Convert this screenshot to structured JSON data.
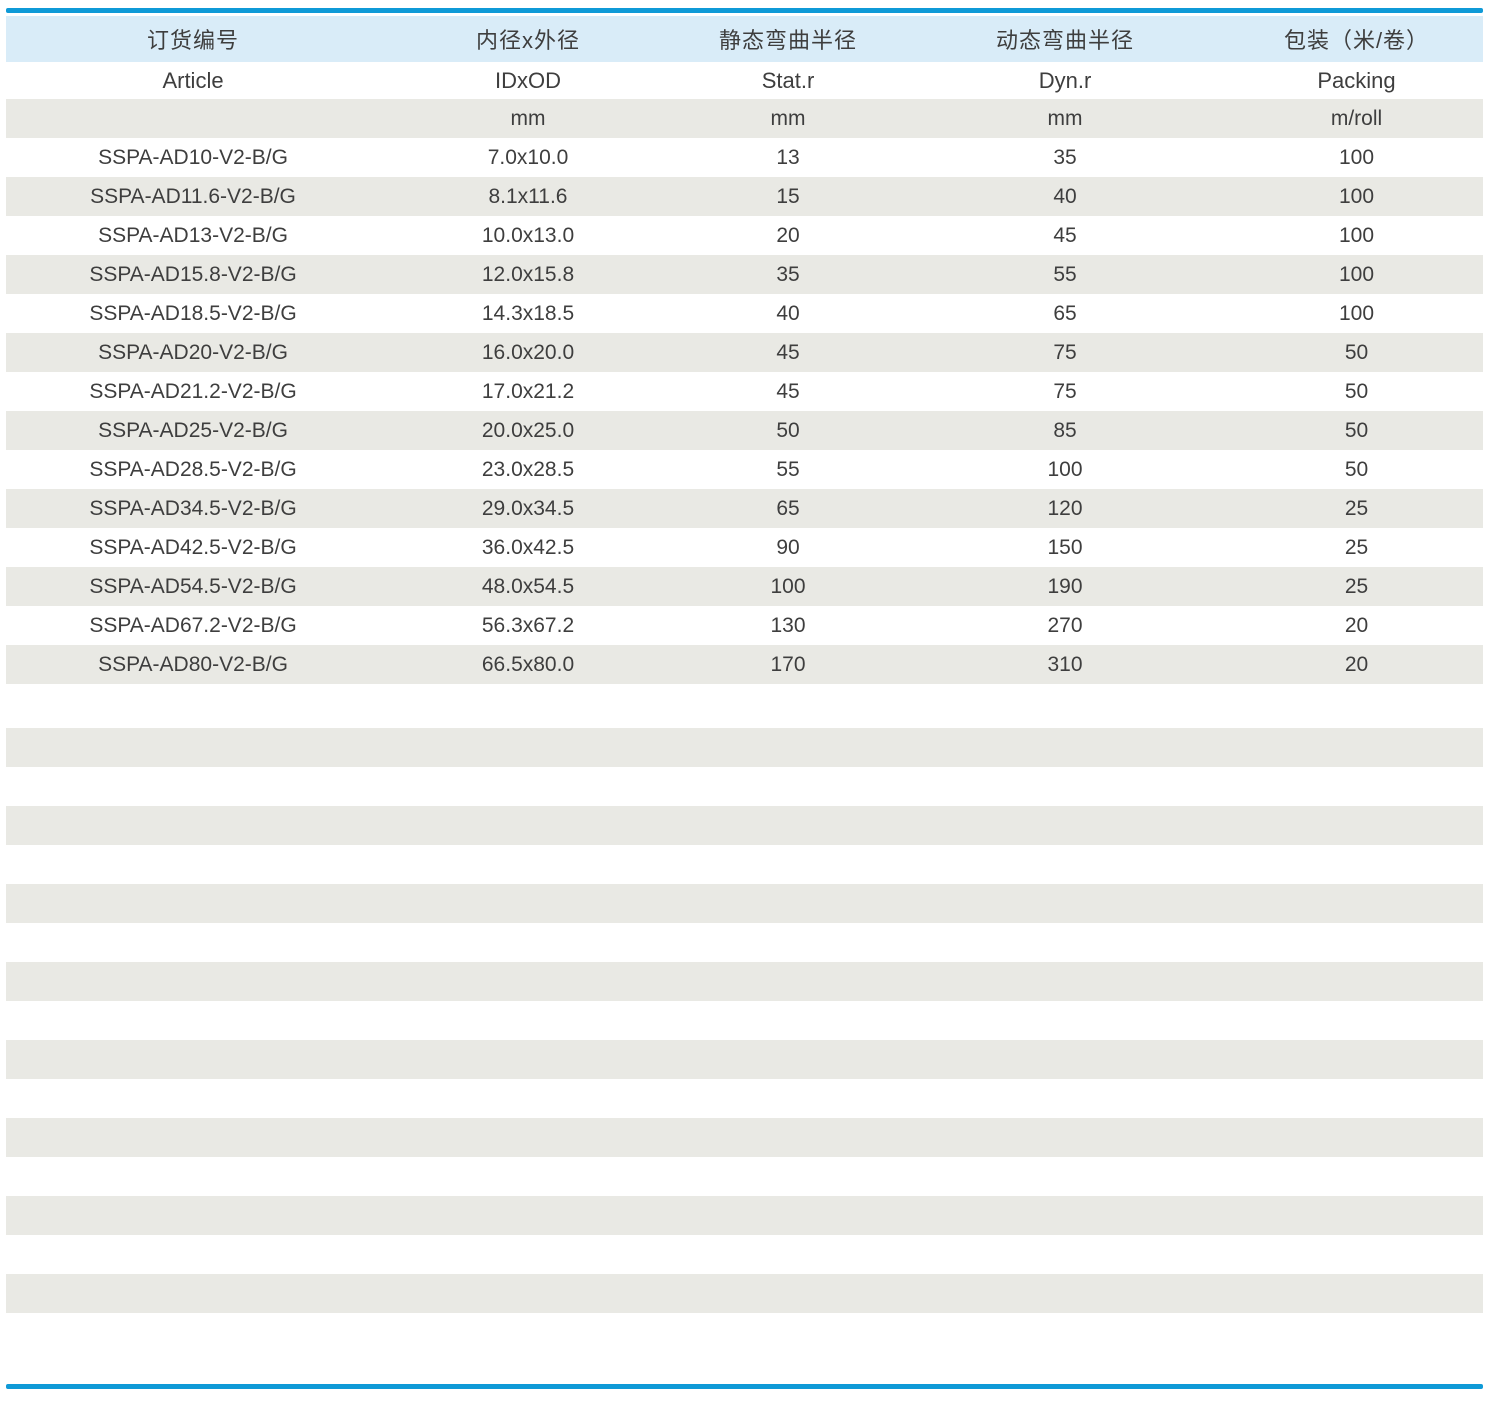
{
  "colors": {
    "accent_blue": "#0f9ad7",
    "header_band_blue": "#d9ecf8",
    "zebra_stripe_gray": "#e9e9e4",
    "text": "#3e3e3e"
  },
  "table": {
    "columns": [
      {
        "zh": "订货编号",
        "en": "Article",
        "unit": ""
      },
      {
        "zh": "内径x外径",
        "en": "IDxOD",
        "unit": "mm"
      },
      {
        "zh": "静态弯曲半径",
        "en": "Stat.r",
        "unit": "mm"
      },
      {
        "zh": "动态弯曲半径",
        "en": "Dyn.r",
        "unit": "mm"
      },
      {
        "zh": "包装（米/卷）",
        "en": "Packing",
        "unit": "m/roll"
      }
    ],
    "rows": [
      [
        "SSPA-AD10-V2-B/G",
        "7.0x10.0",
        "13",
        "35",
        "100"
      ],
      [
        "SSPA-AD11.6-V2-B/G",
        "8.1x11.6",
        "15",
        "40",
        "100"
      ],
      [
        "SSPA-AD13-V2-B/G",
        "10.0x13.0",
        "20",
        "45",
        "100"
      ],
      [
        "SSPA-AD15.8-V2-B/G",
        "12.0x15.8",
        "35",
        "55",
        "100"
      ],
      [
        "SSPA-AD18.5-V2-B/G",
        "14.3x18.5",
        "40",
        "65",
        "100"
      ],
      [
        "SSPA-AD20-V2-B/G",
        "16.0x20.0",
        "45",
        "75",
        "50"
      ],
      [
        "SSPA-AD21.2-V2-B/G",
        "17.0x21.2",
        "45",
        "75",
        "50"
      ],
      [
        "SSPA-AD25-V2-B/G",
        "20.0x25.0",
        "50",
        "85",
        "50"
      ],
      [
        "SSPA-AD28.5-V2-B/G",
        "23.0x28.5",
        "55",
        "100",
        "50"
      ],
      [
        "SSPA-AD34.5-V2-B/G",
        "29.0x34.5",
        "65",
        "120",
        "25"
      ],
      [
        "SSPA-AD42.5-V2-B/G",
        "36.0x42.5",
        "90",
        "150",
        "25"
      ],
      [
        "SSPA-AD54.5-V2-B/G",
        "48.0x54.5",
        "100",
        "190",
        "25"
      ],
      [
        "SSPA-AD67.2-V2-B/G",
        "56.3x67.2",
        "130",
        "270",
        "20"
      ],
      [
        "SSPA-AD80-V2-B/G",
        "66.5x80.0",
        "170",
        "310",
        "20"
      ]
    ]
  }
}
